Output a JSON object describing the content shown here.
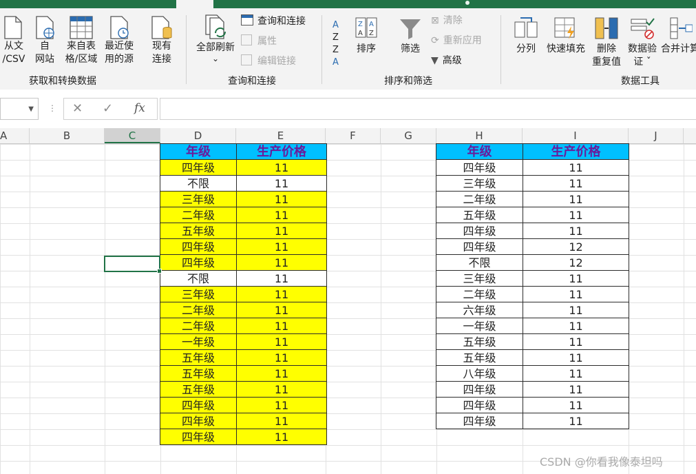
{
  "ribbon": {
    "get_transform": {
      "group_label": "获取和转换数据",
      "from_text_line1": "从文",
      "from_text_line2": "/CSV",
      "from_web_line1": "自",
      "from_web_line2": "网站",
      "from_table_line1": "来自表",
      "from_table_line2": "格/区域",
      "recent_line1": "最近使",
      "recent_line2": "用的源",
      "existing_line1": "现有",
      "existing_line2": "连接"
    },
    "queries": {
      "group_label": "查询和连接",
      "refresh_all": "全部刷新",
      "refresh_arrow": "⌄",
      "queries_connections": "查询和连接",
      "properties": "属性",
      "edit_links": "编辑链接"
    },
    "sort_filter": {
      "group_label": "排序和筛选",
      "sort": "排序",
      "filter": "筛选",
      "clear": "清除",
      "reapply": "重新应用",
      "advanced": "高级"
    },
    "data_tools": {
      "group_label": "数据工具",
      "split": "分列",
      "flash_fill": "快速填充",
      "remove_dup_line1": "删除",
      "remove_dup_line2": "重复值",
      "validation_line1": "数据验",
      "validation_line2": "证 ˇ",
      "consolidate": "合并计算"
    }
  },
  "formula_bar": {
    "fx": "fx",
    "cancel": "✕",
    "confirm": "✓",
    "value": ""
  },
  "columns": [
    "A",
    "B",
    "C",
    "D",
    "E",
    "F",
    "G",
    "H",
    "I",
    "J"
  ],
  "table_left": {
    "headers": [
      "年级",
      "生产价格"
    ],
    "rows": [
      {
        "grade": "四年级",
        "price": "11",
        "fill": "y"
      },
      {
        "grade": "不限",
        "price": "11",
        "fill": "w"
      },
      {
        "grade": "三年级",
        "price": "11",
        "fill": "y"
      },
      {
        "grade": "二年级",
        "price": "11",
        "fill": "y"
      },
      {
        "grade": "五年级",
        "price": "11",
        "fill": "y"
      },
      {
        "grade": "四年级",
        "price": "11",
        "fill": "y"
      },
      {
        "grade": "四年级",
        "price": "11",
        "fill": "y"
      },
      {
        "grade": "不限",
        "price": "11",
        "fill": "w"
      },
      {
        "grade": "三年级",
        "price": "11",
        "fill": "y"
      },
      {
        "grade": "二年级",
        "price": "11",
        "fill": "y"
      },
      {
        "grade": "二年级",
        "price": "11",
        "fill": "y"
      },
      {
        "grade": "一年级",
        "price": "11",
        "fill": "y"
      },
      {
        "grade": "五年级",
        "price": "11",
        "fill": "y"
      },
      {
        "grade": "五年级",
        "price": "11",
        "fill": "y"
      },
      {
        "grade": "五年级",
        "price": "11",
        "fill": "y"
      },
      {
        "grade": "四年级",
        "price": "11",
        "fill": "y"
      },
      {
        "grade": "四年级",
        "price": "11",
        "fill": "y"
      },
      {
        "grade": "四年级",
        "price": "11",
        "fill": "y"
      }
    ]
  },
  "table_right": {
    "headers": [
      "年级",
      "生产价格"
    ],
    "rows": [
      {
        "grade": "四年级",
        "price": "11"
      },
      {
        "grade": "三年级",
        "price": "11"
      },
      {
        "grade": "二年级",
        "price": "11"
      },
      {
        "grade": "五年级",
        "price": "11"
      },
      {
        "grade": "四年级",
        "price": "11"
      },
      {
        "grade": "四年级",
        "price": "12"
      },
      {
        "grade": "不限",
        "price": "12"
      },
      {
        "grade": "三年级",
        "price": "11"
      },
      {
        "grade": "二年级",
        "price": "11"
      },
      {
        "grade": "六年级",
        "price": "11"
      },
      {
        "grade": "一年级",
        "price": "11"
      },
      {
        "grade": "五年级",
        "price": "11"
      },
      {
        "grade": "五年级",
        "price": "11"
      },
      {
        "grade": "八年级",
        "price": "11"
      },
      {
        "grade": "四年级",
        "price": "11"
      },
      {
        "grade": "四年级",
        "price": "11"
      },
      {
        "grade": "四年级",
        "price": "11"
      }
    ]
  },
  "watermark": "CSDN @你看我像泰坦吗",
  "colors": {
    "excel_green": "#217346",
    "header_fill": "#00c0ff",
    "header_text": "#6a1b9a",
    "highlight_fill": "#ffff00"
  }
}
